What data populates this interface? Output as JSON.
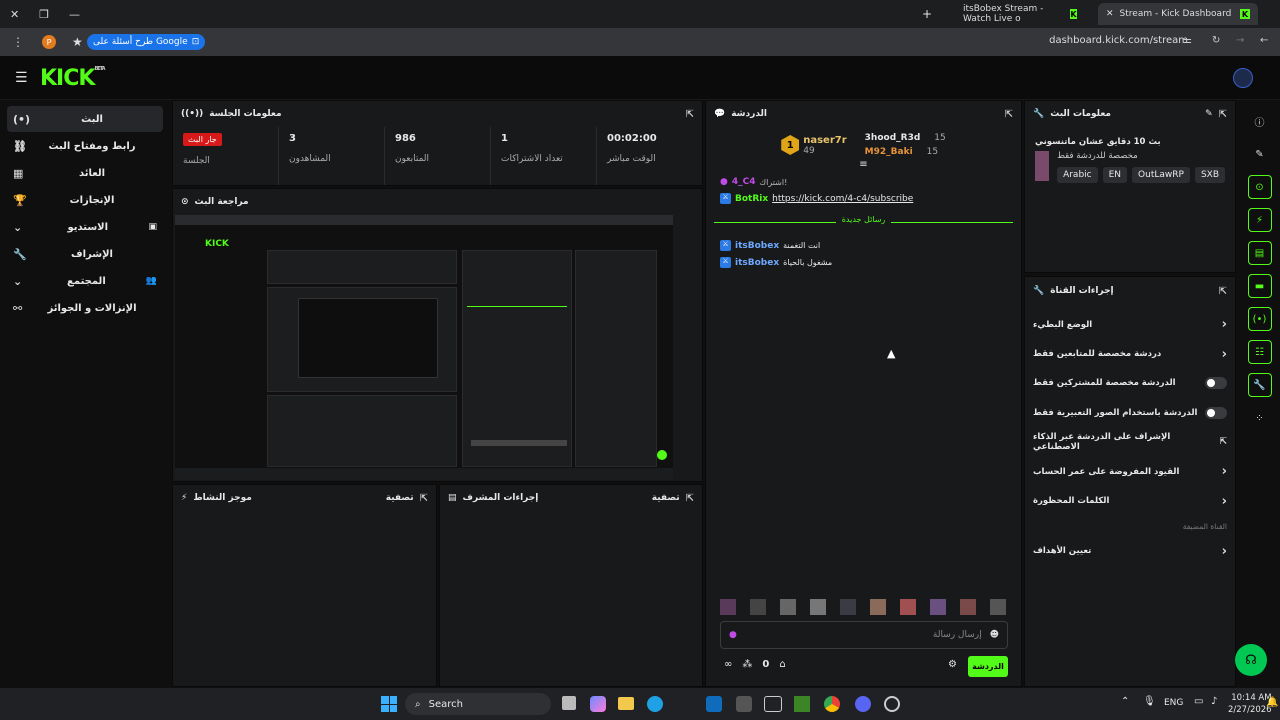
{
  "browser": {
    "tabs": [
      {
        "label": "itsBobex Stream - Watch Live o",
        "active": false
      },
      {
        "label": "Stream - Kick Dashboard",
        "active": true
      }
    ],
    "google_pill": "طرح أسئلة على Google",
    "url": "dashboard.kick.com/stream",
    "profile": "P"
  },
  "nav": [
    {
      "label": "البث",
      "icon": "(•)"
    },
    {
      "label": "رابط ومفتاح البث",
      "icon": "⛓"
    },
    {
      "label": "العائد",
      "icon": "▦"
    },
    {
      "label": "الإنجازات",
      "icon": "🏆"
    },
    {
      "label": "الاستديو",
      "icon": "⌄"
    },
    {
      "label": "الإشراف",
      "icon": "🔧"
    },
    {
      "label": "المجتمع",
      "icon": "⌄"
    },
    {
      "label": "الإنزالات و الجوائز",
      "icon": "⚯"
    }
  ],
  "session": {
    "title": "معلومات الجلسة",
    "stats": [
      {
        "value": "",
        "label": "الجلسة",
        "live": "جار البث"
      },
      {
        "value": "3",
        "label": "المشاهدون"
      },
      {
        "value": "986",
        "label": "المتابعون"
      },
      {
        "value": "1",
        "label": "تعداد الاشتراكات"
      },
      {
        "value": "00:02:00",
        "label": "الوقت مباشر"
      }
    ]
  },
  "preview": {
    "title": "مراجعة البث"
  },
  "activity": {
    "title": "موجز النشاط",
    "filter": "تصفية"
  },
  "modactions": {
    "title": "إجراءات المشرف",
    "filter": "تصفية"
  },
  "chat": {
    "title": "الدردشة",
    "leaders": [
      {
        "rank": "1",
        "name": "naser7r",
        "count": "49"
      },
      {
        "name": "3hood_R3d",
        "count": "15"
      },
      {
        "name": "M92_Baki",
        "count": "15"
      }
    ],
    "messages": [
      {
        "user": "4_C4",
        "text": "اشتراك!",
        "color": "#c04be6"
      },
      {
        "user": "BotRix",
        "text": "https://kick.com/4-c4/subscribe",
        "color": "#53fc18"
      }
    ],
    "new_label": "رسائل جديدة",
    "new_messages": [
      {
        "user": "itsBobex",
        "text": "انت التغمنة"
      },
      {
        "user": "itsBobex",
        "text": "مشغول بالحياة"
      }
    ],
    "input_placeholder": "إرسال رسالة",
    "send": "الدردشة",
    "points": "0"
  },
  "streaminfo": {
    "title": "معلومات البث",
    "stream_title": "بث 10 دقايق عشان ماتنسوني",
    "category": "مخصصة للدردشة فقط",
    "tags": [
      "Arabic",
      "EN",
      "OutLawRP",
      "SXB"
    ]
  },
  "channel": {
    "title": "إجراءات القناة",
    "actions": [
      {
        "label": "الوضع البطيء",
        "type": "chevron"
      },
      {
        "label": "دردشة مخصصة للمتابعين فقط",
        "type": "chevron"
      },
      {
        "label": "الدردشة مخصصة للمشتركين فقط",
        "type": "toggle"
      },
      {
        "label": "الدردشة باستخدام الصور التعبيرية فقط",
        "type": "toggle"
      },
      {
        "label": "الإشراف على الدردشة عبر الذكاء الاصطناعي",
        "type": "external"
      },
      {
        "label": "القيود المفروضة على عمر الحساب",
        "type": "chevron"
      },
      {
        "label": "الكلمات المحظورة",
        "type": "chevron"
      }
    ],
    "sub": "القناة المضيفة",
    "goal": "تعيين الأهداف"
  },
  "taskbar": {
    "search": "Search",
    "lang": "ENG",
    "time": "10:14 AM",
    "date": "2/27/2026"
  }
}
